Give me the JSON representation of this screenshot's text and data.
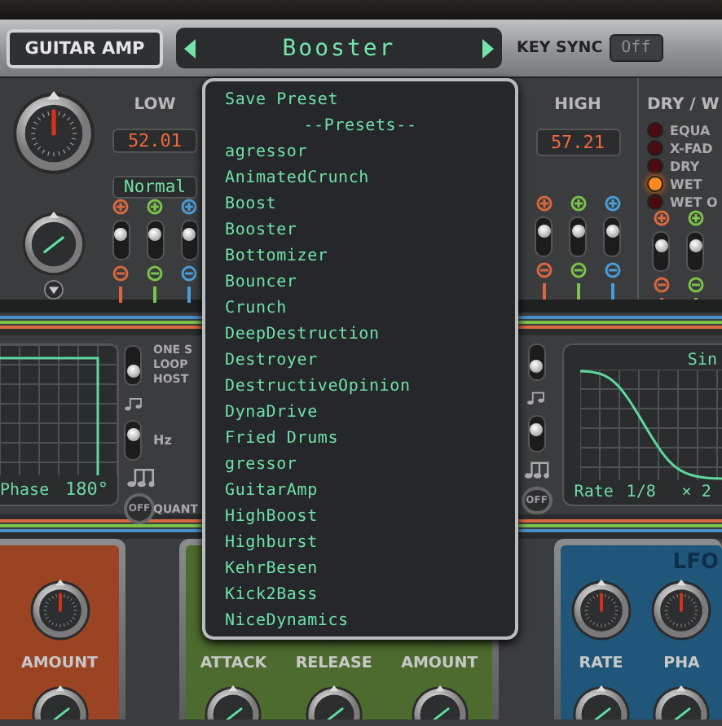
{
  "header": {
    "plugin_button": "GUITAR AMP",
    "preset": "Booster",
    "key_sync_label": "KEY SYNC",
    "key_sync_value": "Off"
  },
  "low": {
    "label": "LOW",
    "value": "52.01",
    "mode": "Normal",
    "switches": [
      {
        "on": true
      },
      {
        "on": true
      },
      {
        "on": true
      }
    ]
  },
  "high": {
    "label": "HIGH",
    "value": "57.21",
    "switches": [
      {
        "on": true
      },
      {
        "on": true
      },
      {
        "on": true
      }
    ]
  },
  "dry_wet": {
    "label": "DRY / W",
    "options": [
      {
        "label": "EQUA",
        "selected": false
      },
      {
        "label": "X-FAD",
        "selected": false
      },
      {
        "label": "DRY",
        "selected": false
      },
      {
        "label": "WET",
        "selected": true
      },
      {
        "label": "WET O",
        "selected": false
      }
    ],
    "switches": [
      {
        "on": true
      },
      {
        "on": true
      }
    ]
  },
  "lfo_left": {
    "switches": [
      {
        "on": false
      },
      {
        "on": true
      }
    ],
    "sync_options": [
      "ONE S",
      "LOOP",
      "HOST"
    ],
    "hz_label": "Hz",
    "off_button": "OFF",
    "quantize_label": "QUANT",
    "phase_label": "Phase",
    "phase_value": "180°"
  },
  "lfo_right": {
    "switches": [
      {
        "on": false
      },
      {
        "on": true
      }
    ],
    "waveform": "Sin",
    "rate_label": "Rate",
    "rate_value": "1/8",
    "multiplier": "× 2",
    "off_button": "OFF"
  },
  "bottom_panels": [
    {
      "color": "#9a4423",
      "labels": [
        "AMOUNT"
      ]
    },
    {
      "color": "#4d6b2e",
      "labels": [
        "ATTACK",
        "RELEASE",
        "AMOUNT"
      ]
    },
    {
      "color": "#1f5679",
      "title": "LFO",
      "labels": [
        "RATE",
        "PHA"
      ]
    }
  ],
  "preset_menu": {
    "items": [
      {
        "label": "Save Preset",
        "kind": "action"
      },
      {
        "label": "--Presets--",
        "kind": "heading"
      },
      {
        "label": "agressor",
        "kind": "preset"
      },
      {
        "label": "AnimatedCrunch",
        "kind": "preset"
      },
      {
        "label": "Boost",
        "kind": "preset"
      },
      {
        "label": "Booster",
        "kind": "preset"
      },
      {
        "label": "Bottomizer",
        "kind": "preset"
      },
      {
        "label": "Bouncer",
        "kind": "preset"
      },
      {
        "label": "Crunch",
        "kind": "preset"
      },
      {
        "label": "DeepDestruction",
        "kind": "preset"
      },
      {
        "label": "Destroyer",
        "kind": "preset"
      },
      {
        "label": "DestructiveOpinion",
        "kind": "preset"
      },
      {
        "label": "DynaDrive",
        "kind": "preset"
      },
      {
        "label": "Fried Drums",
        "kind": "preset"
      },
      {
        "label": "gressor",
        "kind": "preset"
      },
      {
        "label": "GuitarAmp",
        "kind": "preset"
      },
      {
        "label": "HighBoost",
        "kind": "preset"
      },
      {
        "label": "Highburst",
        "kind": "preset"
      },
      {
        "label": "KehrBesen",
        "kind": "preset"
      },
      {
        "label": "Kick2Bass",
        "kind": "preset"
      },
      {
        "label": "NiceDynamics",
        "kind": "preset"
      }
    ]
  }
}
